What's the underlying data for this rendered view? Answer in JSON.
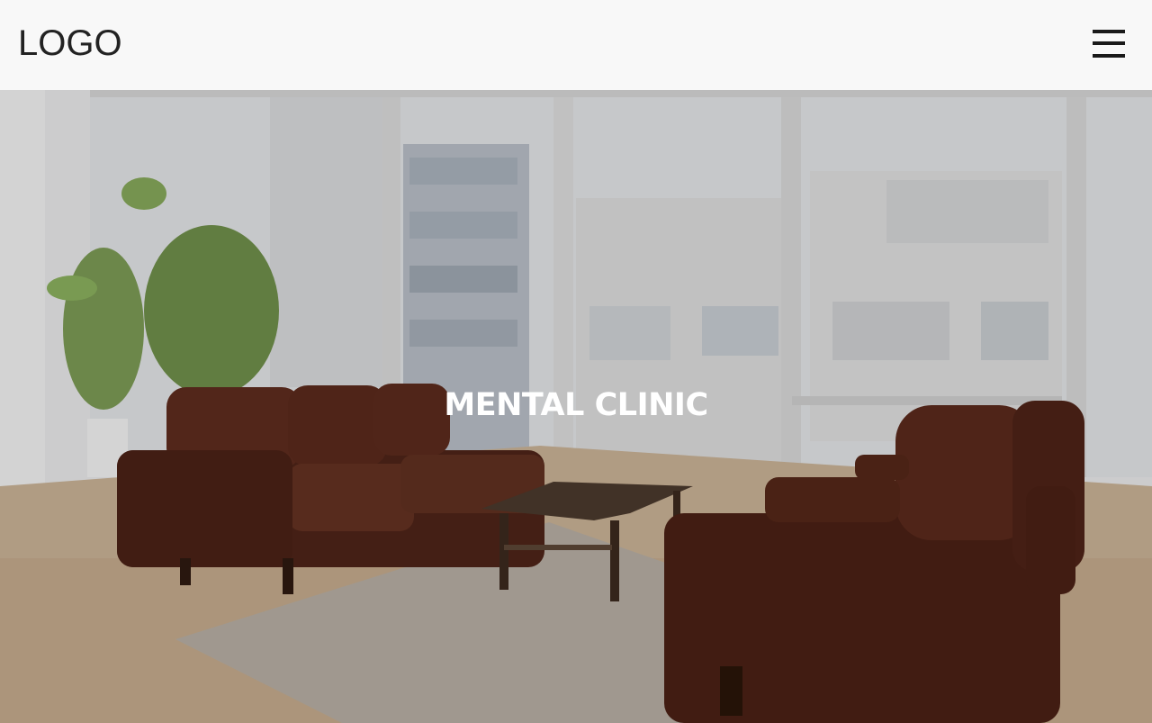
{
  "header": {
    "logo_text": "LOGO",
    "menu_icon": "hamburger-menu-icon"
  },
  "hero": {
    "title": "MENTAL CLINIC",
    "image_description_icon": "hero-photo"
  },
  "colors": {
    "header_bg": "#f8f8f8",
    "text_dark": "#222222",
    "hero_text": "#ffffff",
    "sofa": "#5a2a1c"
  }
}
